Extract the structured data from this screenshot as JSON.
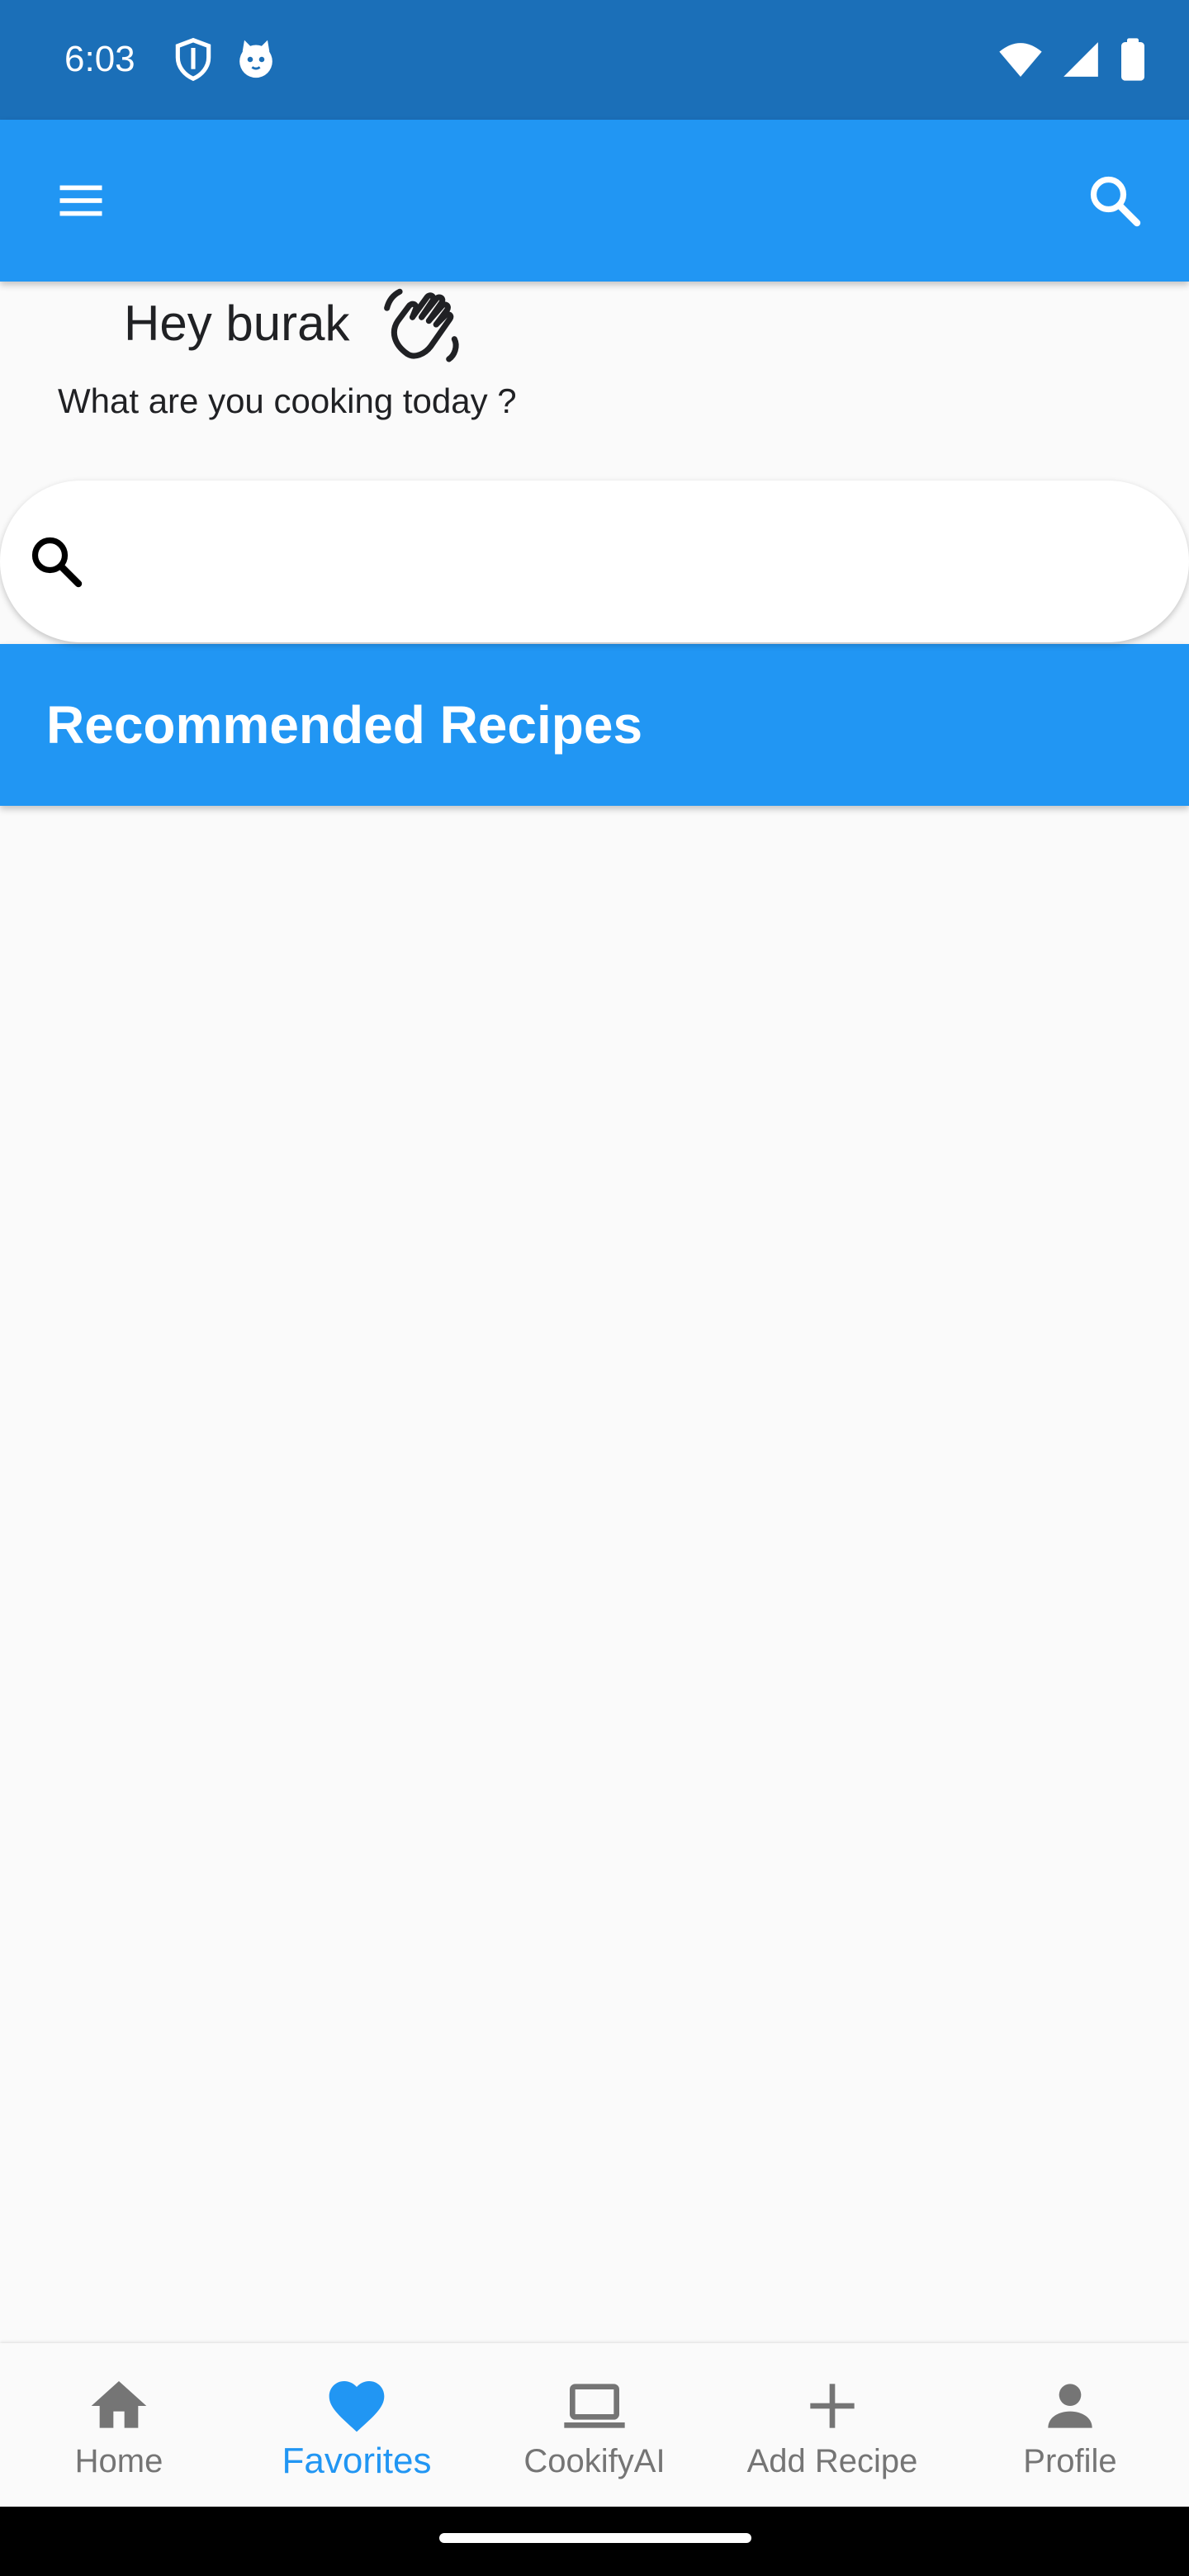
{
  "status_bar": {
    "time": "6:03",
    "icons": [
      "shield-icon",
      "cat-icon",
      "wifi-icon",
      "signal-icon",
      "battery-icon"
    ]
  },
  "app_bar": {
    "icons": [
      "menu-icon",
      "search-icon"
    ]
  },
  "greeting": {
    "title": "Hey burak",
    "subtitle": "What are you cooking today ?",
    "icon": "waving-hand-icon"
  },
  "search": {
    "value": "",
    "placeholder": "",
    "icon": "search-icon"
  },
  "section": {
    "title": "Recommended Recipes"
  },
  "bottom_nav": {
    "items": [
      {
        "label": "Home",
        "icon": "home-icon"
      },
      {
        "label": "Favorites",
        "icon": "heart-icon"
      },
      {
        "label": "CookifyAI",
        "icon": "laptop-icon"
      },
      {
        "label": "Add Recipe",
        "icon": "plus-icon"
      },
      {
        "label": "Profile",
        "icon": "person-icon"
      }
    ],
    "active": "Favorites"
  },
  "colors": {
    "primary": "#2196f3",
    "status_bar": "#1b6fb8",
    "background": "#fafafa",
    "nav_inactive": "#757575"
  }
}
